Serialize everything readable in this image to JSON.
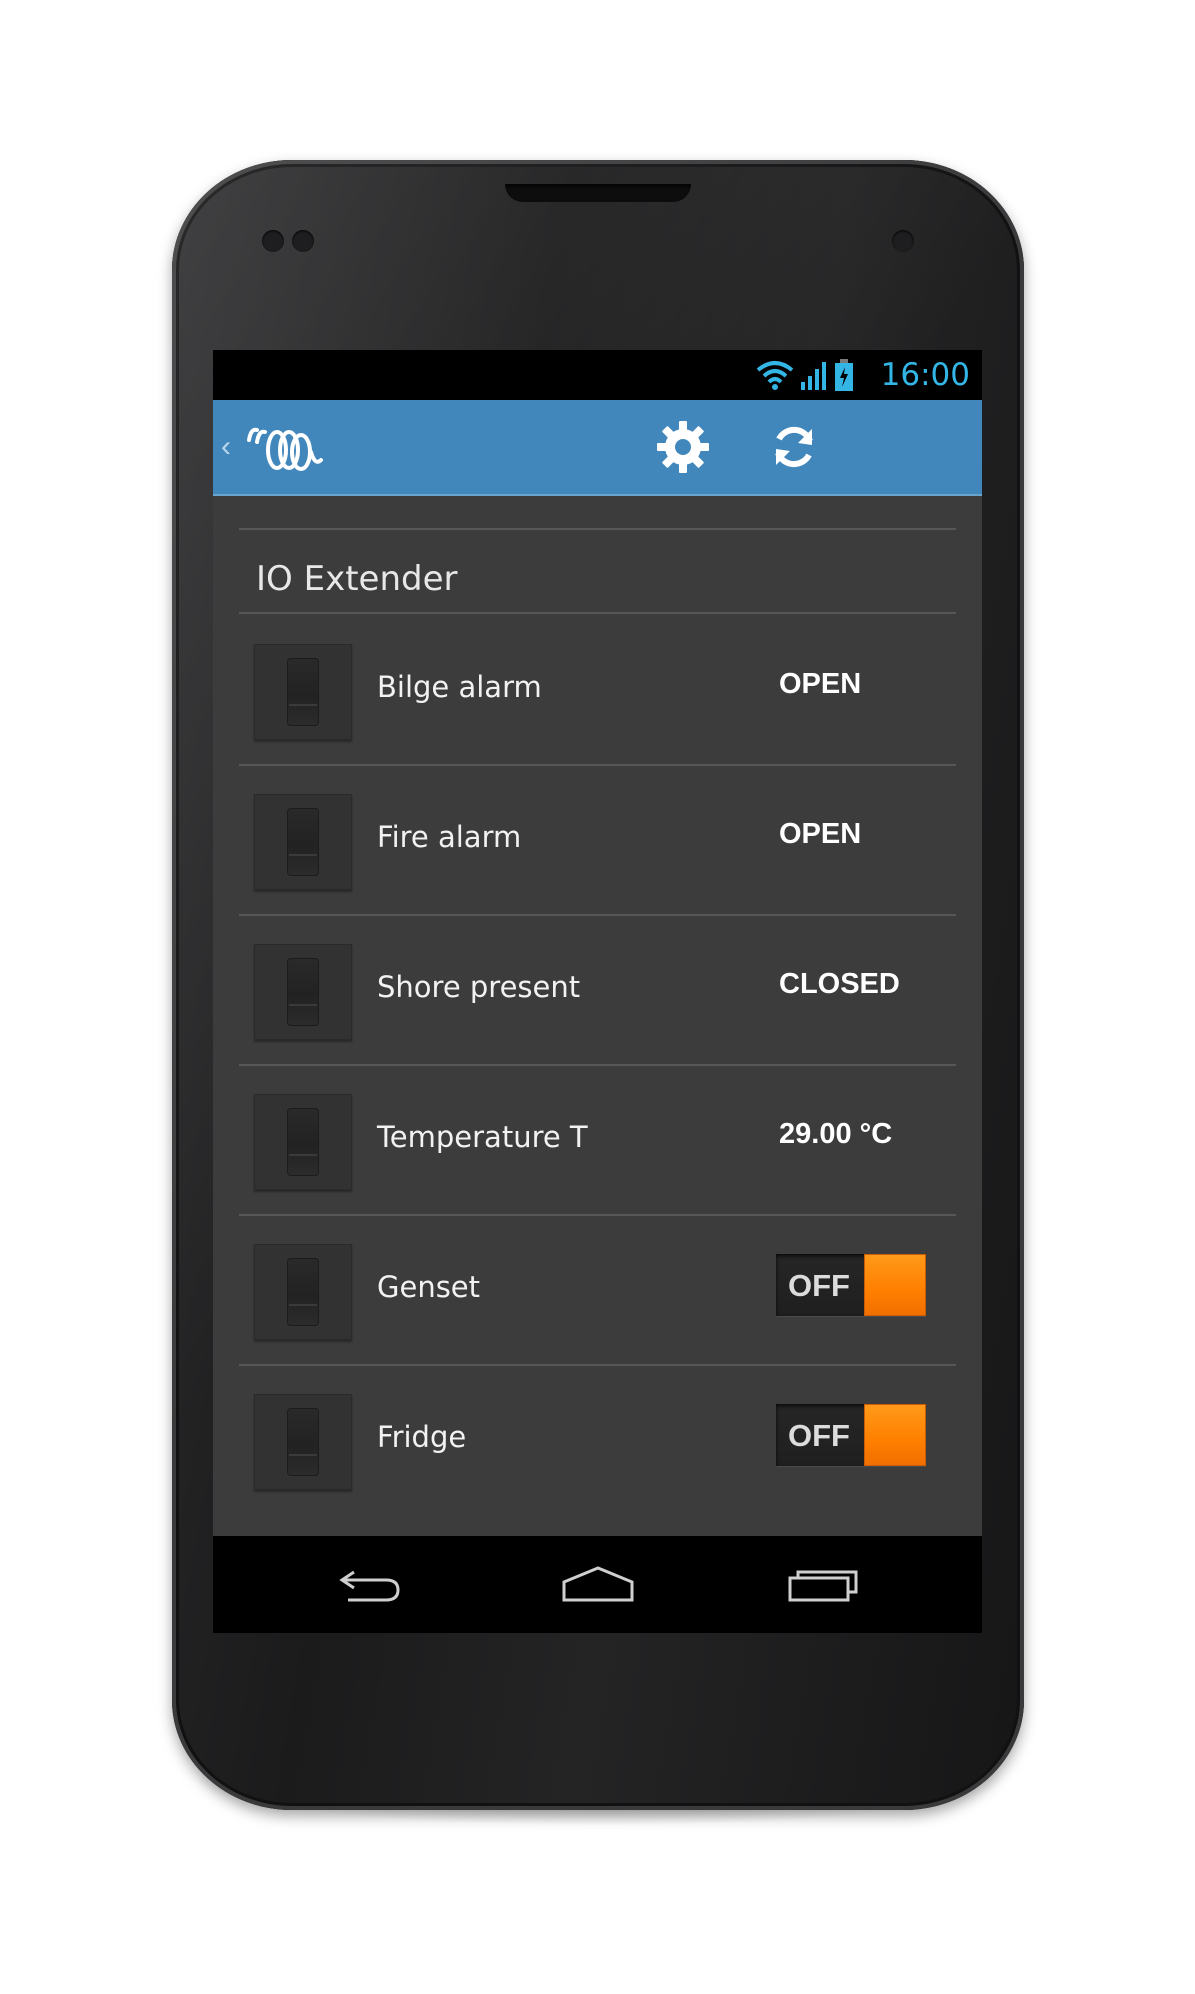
{
  "status_bar": {
    "time": "16:00"
  },
  "action_bar": {
    "settings_icon": "gear-icon",
    "refresh_icon": "refresh-icon",
    "logo_icon": "victron-logo"
  },
  "section": {
    "title": "IO Extender"
  },
  "rows": [
    {
      "label": "Bilge alarm",
      "value": "OPEN",
      "kind": "status"
    },
    {
      "label": "Fire alarm",
      "value": "OPEN",
      "kind": "status"
    },
    {
      "label": "Shore present",
      "value": "CLOSED",
      "kind": "status"
    },
    {
      "label": "Temperature T",
      "value": "29.00 °C",
      "kind": "status"
    },
    {
      "label": "Genset",
      "value": "OFF",
      "kind": "toggle"
    },
    {
      "label": "Fridge",
      "value": "OFF",
      "kind": "toggle"
    }
  ],
  "nav_bar": {
    "back_icon": "back-icon",
    "home_icon": "home-icon",
    "recents_icon": "recents-icon"
  },
  "colors": {
    "action_bar": "#4187bb",
    "status_accent": "#33b5e5",
    "toggle_thumb": "#ff7f00",
    "list_background": "#3c3c3c"
  }
}
